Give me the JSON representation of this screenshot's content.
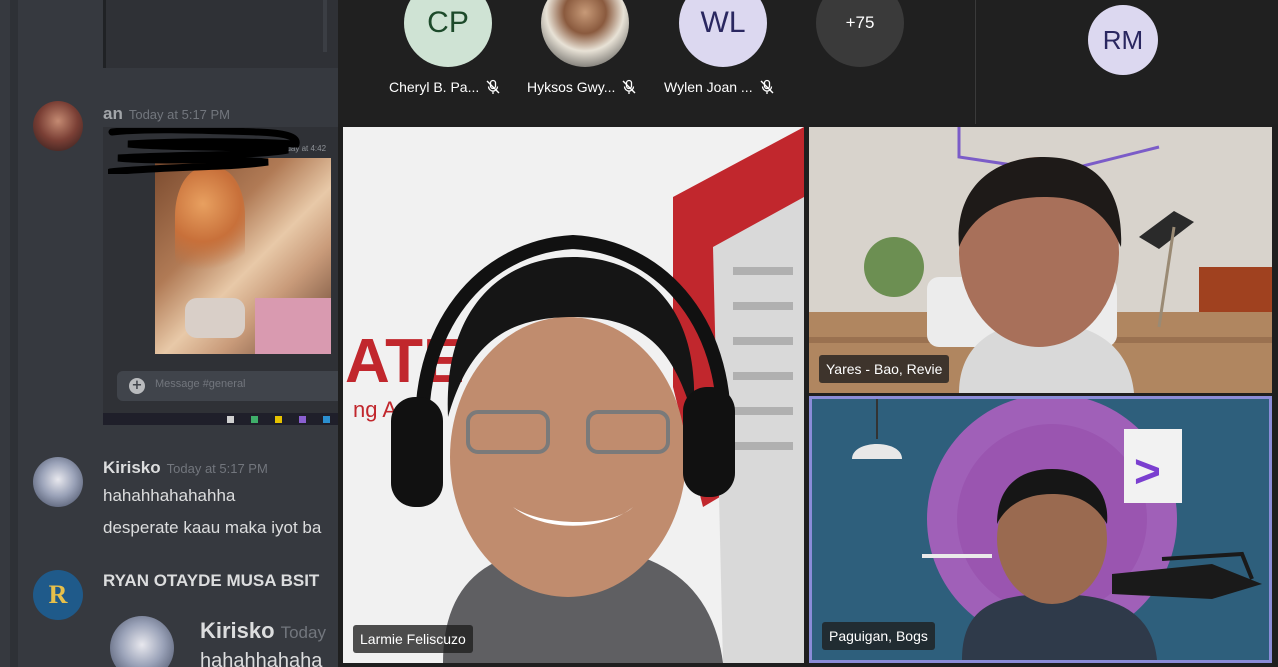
{
  "chat": {
    "messages": [
      {
        "author": "an",
        "timestamp": "Today at 5:17 PM"
      },
      {
        "author": "Kirisko",
        "timestamp": "Today at 5:17 PM",
        "lines": [
          "hahahhahahahha",
          "desperate kaau maka iyot ba"
        ]
      },
      {
        "author": "RYAN OTAYDE MUSA BSIT"
      },
      {
        "author": "Kirisko",
        "timestamp": "Today",
        "lines": [
          "hahahhahaha"
        ]
      }
    ],
    "shared_screenshot": {
      "timestamp": "Today at 4:42",
      "message_placeholder": "Message #general"
    }
  },
  "meeting": {
    "roster": [
      {
        "initials": "CP",
        "name": "Cheryl B. Pa...",
        "muted": true,
        "color": "#cfe3d4",
        "text_color": "#1d4a2a"
      },
      {
        "initials": "",
        "name": "Hyksos Gwy...",
        "muted": true,
        "photo": true
      },
      {
        "initials": "WL",
        "name": "Wylen Joan ...",
        "muted": true,
        "color": "#dcd8f0",
        "text_color": "#2a2760"
      },
      {
        "initials": "+75",
        "name": "",
        "muted": false,
        "color": "#3a3a3a",
        "text_color": "#ffffff"
      }
    ],
    "right_avatar": {
      "initials": "RM",
      "color": "#dcd8f0",
      "text_color": "#2a2760"
    },
    "tiles": [
      {
        "name": "Larmie Feliscuzo"
      },
      {
        "name": "Yares - Bao, Revie"
      },
      {
        "name": "Paguigan, Bogs",
        "active_speaker": true
      }
    ]
  }
}
